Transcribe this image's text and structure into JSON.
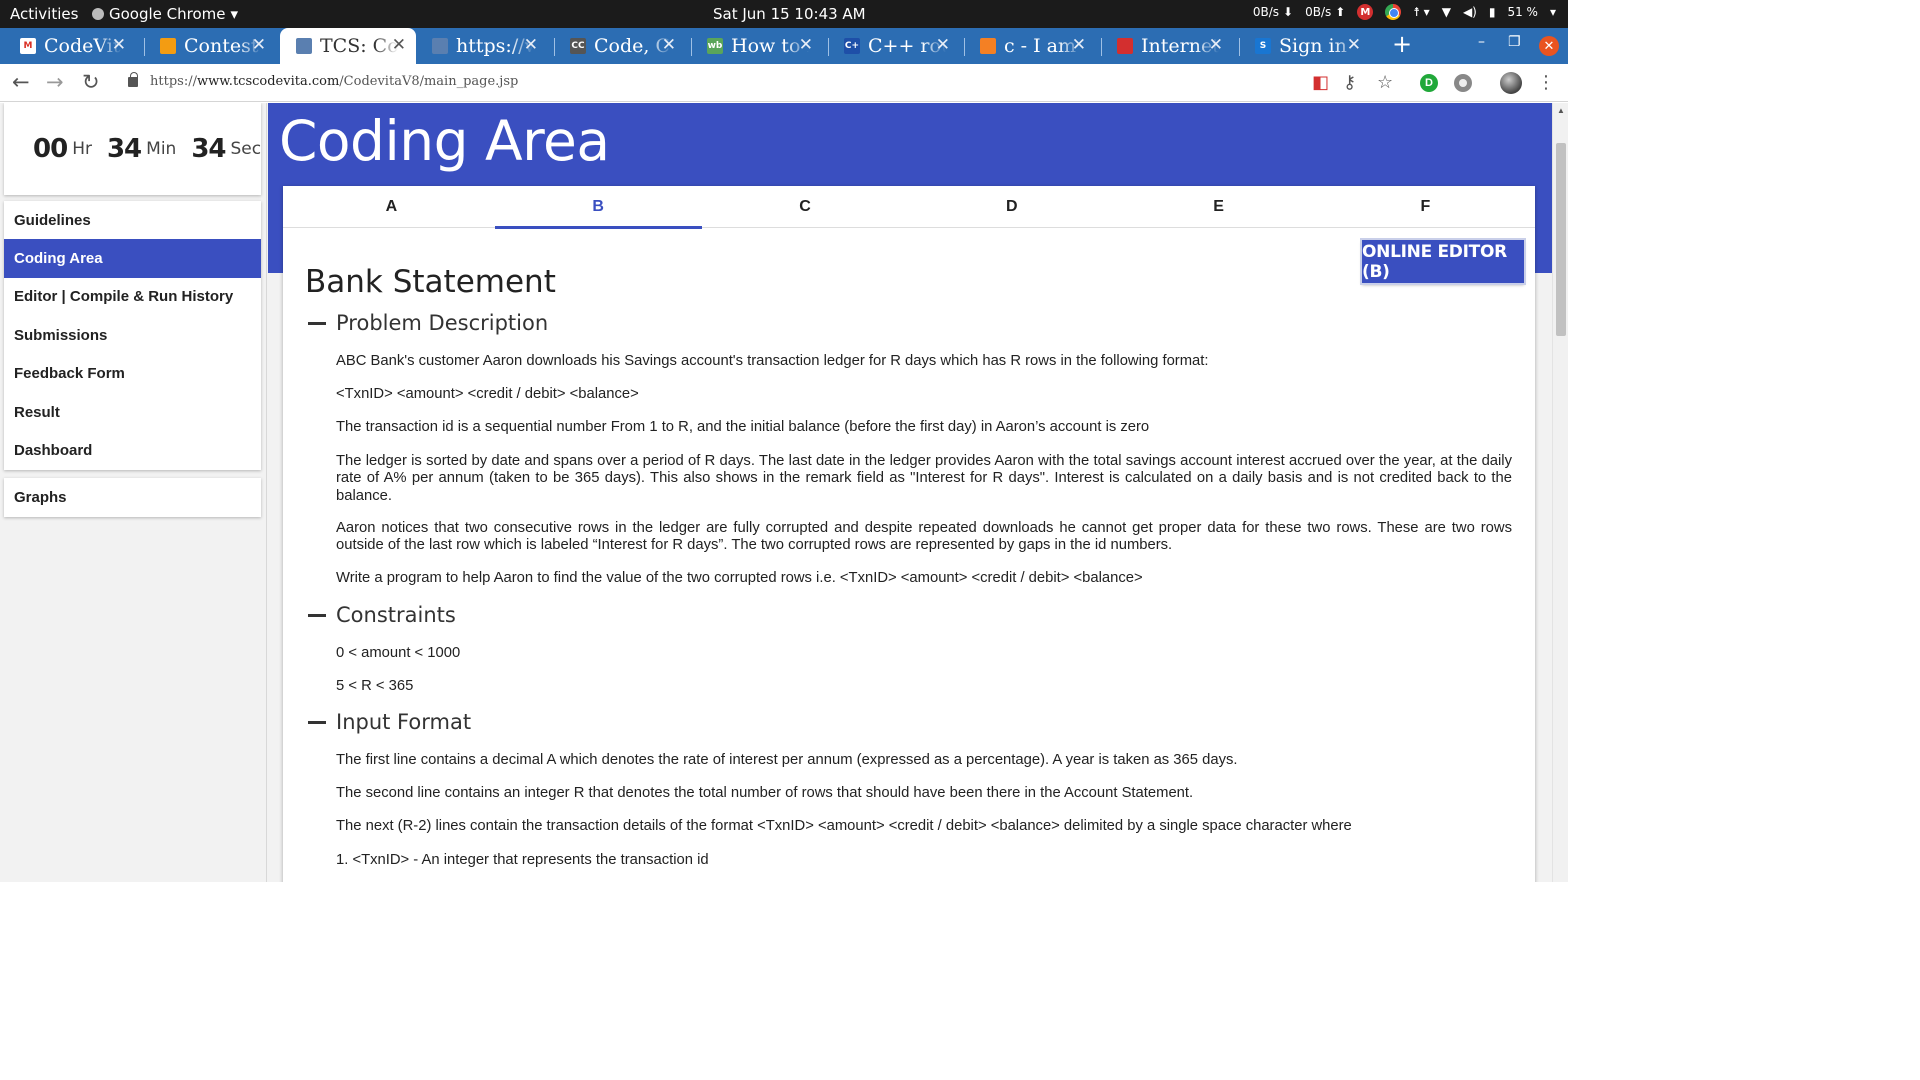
{
  "system_bar": {
    "activities": "Activities",
    "app_name": "Google Chrome",
    "clock": "Sat Jun 15  10:43 AM",
    "net_down": "0B/s",
    "net_up": "0B/s",
    "mail_badge": "M",
    "battery": "51 %"
  },
  "browser": {
    "tabs": [
      {
        "title": "CodeVita",
        "favicon": "gmail-icon",
        "fav_color": "#ffffff",
        "fav_text": "M"
      },
      {
        "title": "Contest",
        "favicon": "contest-icon",
        "fav_color": "#f39c12",
        "fav_text": ""
      },
      {
        "title": "TCS: CodeVita",
        "favicon": "tcs-icon",
        "fav_color": "#5a7fb0",
        "fav_text": ""
      },
      {
        "title": "https://www",
        "favicon": "tcs-icon",
        "fav_color": "#5a7fb0",
        "fav_text": ""
      },
      {
        "title": "Code, Compile",
        "favicon": "cc-icon",
        "fav_color": "#555555",
        "fav_text": "CC"
      },
      {
        "title": "How to round",
        "favicon": "site-icon",
        "fav_color": "#5aa55a",
        "fav_text": "wb"
      },
      {
        "title": "C++ round",
        "favicon": "cplusplus-icon",
        "fav_color": "#1e4fa8",
        "fav_text": "C+"
      },
      {
        "title": "c - I am",
        "favicon": "stackoverflow-icon",
        "fav_color": "#f48024",
        "fav_text": ""
      },
      {
        "title": "Internet",
        "favicon": "speed-icon",
        "fav_color": "#d32f2f",
        "fav_text": ""
      },
      {
        "title": "Sign in",
        "favicon": "s-icon",
        "fav_color": "#1976d2",
        "fav_text": "S"
      }
    ],
    "url_scheme": "https://",
    "url_host": "www.tcscodevita.com",
    "url_path": "/CodevitaV8/main_page.jsp"
  },
  "timer": {
    "hours": "00",
    "hours_unit": "Hr",
    "minutes": "34",
    "minutes_unit": "Min",
    "seconds": "34",
    "seconds_unit": "Sec"
  },
  "sidebar": {
    "items": [
      {
        "label": "Guidelines"
      },
      {
        "label": "Coding Area"
      },
      {
        "label": "Editor | Compile & Run History"
      },
      {
        "label": "Submissions"
      },
      {
        "label": "Feedback Form"
      },
      {
        "label": "Result"
      },
      {
        "label": "Dashboard"
      }
    ],
    "graphs": "Graphs"
  },
  "main": {
    "heading": "Coding Area",
    "problem_tabs": [
      "A",
      "B",
      "C",
      "D",
      "E",
      "F"
    ],
    "editor_button": "ONLINE EDITOR (B)",
    "problem_title": "Bank Statement",
    "sections": {
      "description": "Problem Description",
      "constraints": "Constraints",
      "input_format": "Input Format"
    },
    "description_paragraphs": [
      "ABC Bank's customer Aaron downloads his Savings account's transaction ledger for R days which has R rows in the following format:",
      "<TxnID> <amount> <credit / debit> <balance>",
      "The transaction id is a sequential number From 1 to R, and the initial balance (before the first day) in Aaron’s account is zero",
      "The ledger is sorted by date and spans over a period of R days. The last date in the ledger provides Aaron with the total savings account interest accrued over the year, at the daily rate of A% per annum (taken to be 365 days). This also shows in the remark field as \"Interest for R days\". Interest is calculated on a daily basis and is not credited back to the balance.",
      "Aaron notices that two consecutive rows in the ledger are fully corrupted and despite repeated downloads he cannot get proper data for these two rows. These are two rows outside of the last row which is labeled “Interest for R days”. The two corrupted rows are represented by gaps in the id numbers.",
      "Write a program to help Aaron to find the value of the two corrupted rows i.e. <TxnID> <amount> <credit / debit> <balance>"
    ],
    "constraints": [
      "0 < amount < 1000",
      "5 < R < 365"
    ],
    "input_format_paragraphs": [
      "The first line contains a decimal A which denotes the rate of interest per annum (expressed as a percentage). A year is taken as 365 days.",
      "The second line contains an integer R that denotes the total number of rows that should have been there in the Account Statement.",
      "The next (R-2) lines contain the transaction details of the format <TxnID> <amount> <credit / debit> <balance> delimited by a single space character where",
      "1. <TxnID> - An integer that represents the transaction id"
    ]
  }
}
